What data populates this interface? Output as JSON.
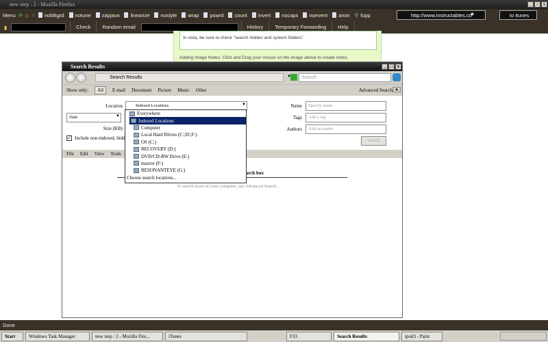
{
  "browser": {
    "title": "new step : 2 - Mozilla Firefox",
    "menu": "Menu",
    "bookmarks": [
      "noblkgrd",
      "notune",
      "zapjava",
      "linearize",
      "nostyle",
      "wrap",
      "pswrd",
      "count",
      "invert",
      "nocaps",
      "noevent",
      "anon",
      "fupp"
    ],
    "url": "http://www.instructables.co",
    "search": "to itunes",
    "toolbar": {
      "check": "Check",
      "random_email": "Random email",
      "history": "History",
      "temp_forwarding": "Temporary Forwarding",
      "help": "Help"
    },
    "status": "Done"
  },
  "page": {
    "note": "In vista, be sure to check \"search hidden and system folders\".",
    "image_notes": "Adding Image Notes: Click and Drag your mouse on the image above to create notes."
  },
  "search_window": {
    "title": "Search Results",
    "address": "Search Results",
    "search_placeholder": "Search",
    "show_only": "Show only:",
    "filters": [
      "All",
      "E-mail",
      "Document",
      "Picture",
      "Music",
      "Other"
    ],
    "advanced": "Advanced Search",
    "location_label": "Location",
    "location_value": "Indexed Locations",
    "date_value": "Date",
    "size_label": "Size (KB)",
    "include_label": "Include non-indexed, hidd",
    "name_label": "Name",
    "name_placeholder": "Specify name",
    "tags_label": "Tags",
    "tags_placeholder": "Add a tag",
    "authors_label": "Authors",
    "authors_placeholder": "Add an author",
    "search_button": "Search",
    "menu": [
      "File",
      "Edit",
      "View",
      "Tools"
    ],
    "dropdown": [
      "Everywhere",
      "Indexed Locations",
      "Computer",
      "Local Hard Drives (C:;D:;F:)",
      "OS (C:)",
      "RECOVERY (D:)",
      "DVD/CD-RW Drive (E:)",
      "maxtor (F:)",
      "RESONANTEYE (G:)",
      "Choose search locations..."
    ],
    "hint_title": "search box",
    "hint": "To search more of your computer, use Advanced Search."
  },
  "taskbar": {
    "start": "Start",
    "items": [
      "Windows Task Manager",
      "new step : 2 - Mozilla Fire...",
      "iTunes",
      "F33",
      "Search Results",
      "ipod3 - Paint"
    ]
  }
}
